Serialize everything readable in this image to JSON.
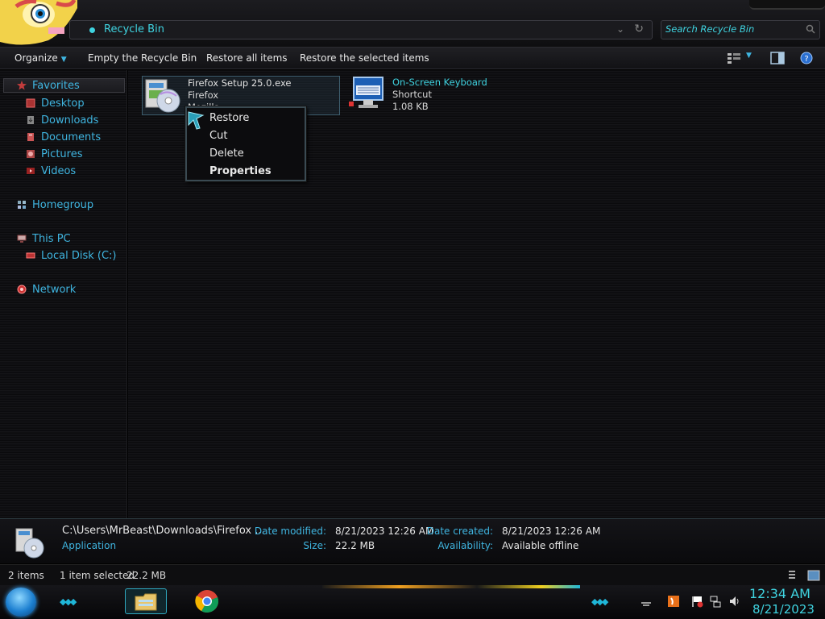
{
  "window": {
    "breadcrumb": "Recycle Bin",
    "search_placeholder": "Search Recycle Bin"
  },
  "toolbar": {
    "organize": "Organize",
    "empty_bin": "Empty the Recycle Bin",
    "restore_all": "Restore all items",
    "restore_selected": "Restore the selected items"
  },
  "nav": {
    "favorites": "Favorites",
    "desktop": "Desktop",
    "downloads": "Downloads",
    "documents": "Documents",
    "pictures": "Pictures",
    "videos": "Videos",
    "homegroup": "Homegroup",
    "this_pc": "This PC",
    "local_disk": "Local Disk (C:)",
    "network": "Network"
  },
  "files": [
    {
      "name": "Firefox Setup 25.0.exe",
      "line2": "Firefox",
      "line3": "Mozilla",
      "icon": "installer-disc-icon"
    },
    {
      "name": "On-Screen Keyboard",
      "line2": "Shortcut",
      "line3": "1.08 KB",
      "icon": "keyboard-monitor-icon"
    }
  ],
  "context_menu": {
    "items": [
      "Restore",
      "Cut",
      "Delete",
      "Properties"
    ]
  },
  "details": {
    "path": "C:\\Users\\MrBeast\\Downloads\\Firefox ...",
    "type": "Application",
    "date_modified_label": "Date modified:",
    "date_modified": "8/21/2023 12:26 AM",
    "size_label": "Size:",
    "size": "22.2 MB",
    "date_created_label": "Date created:",
    "date_created": "8/21/2023 12:26 AM",
    "availability_label": "Availability:",
    "availability": "Available offline"
  },
  "status": {
    "count": "2 items",
    "selected": "1 item selected",
    "selected_size": "22.2 MB"
  },
  "taskbar": {
    "time": "12:34 AM",
    "date": "8/21/2023"
  },
  "colors": {
    "accent": "#3fb5e0",
    "accent_bright": "#3fd3e0",
    "background": "#000000"
  }
}
